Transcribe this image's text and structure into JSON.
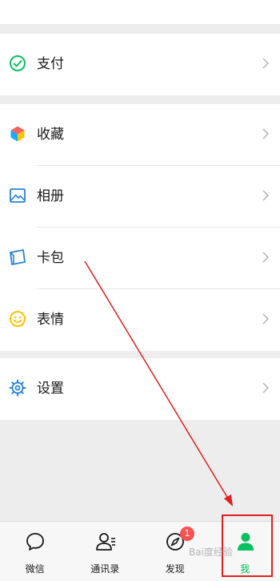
{
  "sections": [
    {
      "items": [
        {
          "label": "支付",
          "icon": "pay-icon"
        }
      ]
    },
    {
      "items": [
        {
          "label": "收藏",
          "icon": "favorites-icon"
        },
        {
          "label": "相册",
          "icon": "album-icon"
        },
        {
          "label": "卡包",
          "icon": "cards-icon"
        },
        {
          "label": "表情",
          "icon": "stickers-icon"
        }
      ]
    },
    {
      "items": [
        {
          "label": "设置",
          "icon": "settings-icon"
        }
      ]
    }
  ],
  "tabbar": {
    "tabs": [
      {
        "label": "微信",
        "icon": "chat-icon"
      },
      {
        "label": "通讯录",
        "icon": "contacts-icon"
      },
      {
        "label": "发现",
        "icon": "discover-icon",
        "badge": "1"
      },
      {
        "label": "我",
        "icon": "me-icon",
        "active": true
      }
    ]
  },
  "watermark": "Bai度经验",
  "colors": {
    "accent": "#07c160",
    "badge": "#fa5151",
    "annotation": "#e02020"
  }
}
